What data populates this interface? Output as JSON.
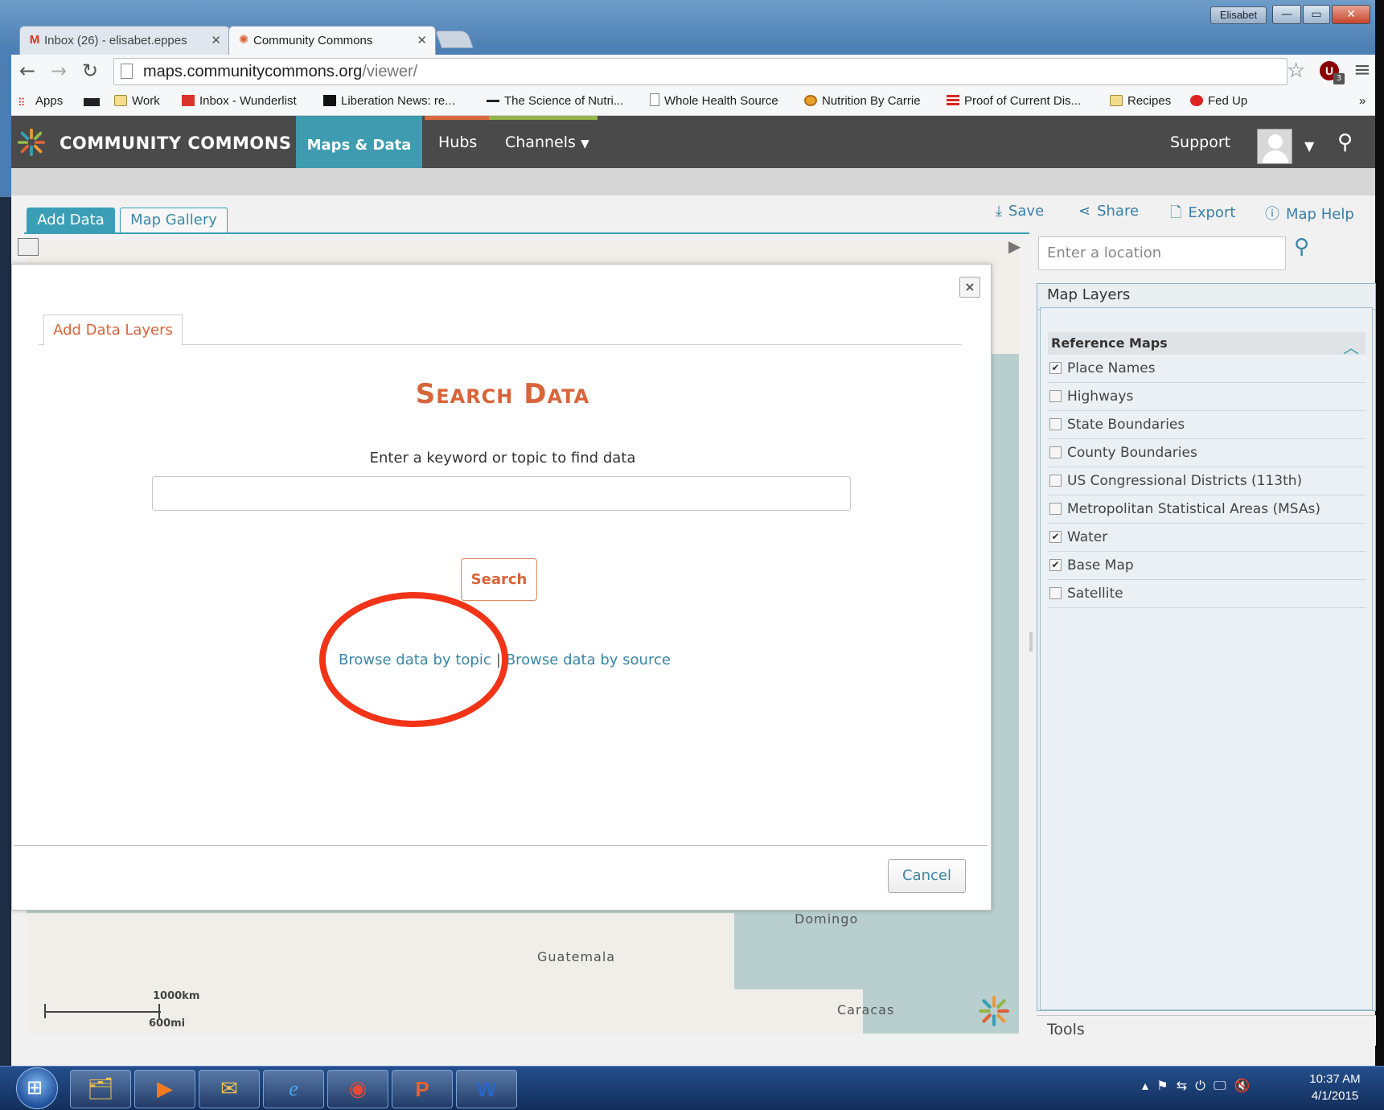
{
  "window": {
    "user_label": "Elisabet"
  },
  "browser": {
    "tabs": [
      {
        "label": "Inbox (26) - elisabet.eppes",
        "icon": "gmail-icon"
      },
      {
        "label": "Community Commons",
        "icon": "community-commons-icon"
      }
    ],
    "url_host": "maps.communitycommons.org",
    "url_path": "/viewer/",
    "bookmarks": [
      {
        "label": "Apps",
        "icon": "apps-grid-icon"
      },
      {
        "label": "",
        "icon": "bbc-icon"
      },
      {
        "label": "Work",
        "icon": "folder-icon"
      },
      {
        "label": "Inbox - Wunderlist",
        "icon": "wunderlist-icon"
      },
      {
        "label": "Liberation News: re...",
        "icon": "liberation-news-icon"
      },
      {
        "label": "The Science of Nutri...",
        "icon": "science-nutrition-icon"
      },
      {
        "label": "Whole Health Source",
        "icon": "page-icon"
      },
      {
        "label": "Nutrition By Carrie",
        "icon": "nutrition-carrie-icon"
      },
      {
        "label": "Proof of Current Dis...",
        "icon": "flag-icon"
      },
      {
        "label": "Recipes",
        "icon": "folder-icon"
      },
      {
        "label": "Fed Up",
        "icon": "fed-up-icon"
      }
    ],
    "bookmarks_overflow": "»",
    "extension_badge": "3"
  },
  "site": {
    "brand": "COMMUNITY COMMONS",
    "nav": {
      "maps": "Maps & Data",
      "hubs": "Hubs",
      "channels": "Channels"
    },
    "support": "Support",
    "accent": "#3f9cb0",
    "orange": "#d8643a"
  },
  "viewer": {
    "tabs": {
      "add_data": "Add Data",
      "map_gallery": "Map Gallery"
    },
    "actions": {
      "save": "Save",
      "share": "Share",
      "export": "Export",
      "help": "Map Help"
    },
    "location_placeholder": "Enter a location"
  },
  "map": {
    "labels": {
      "domingo": "Domingo",
      "guatemala": "Guatemala",
      "caracas": "Caracas"
    },
    "scale_km": "1000km",
    "scale_mi": "600mi"
  },
  "modal": {
    "tab": "Add Data Layers",
    "title": "Search Data",
    "prompt": "Enter a keyword or topic to find data",
    "search_value": "",
    "search_button": "Search",
    "browse_topic": "Browse data by topic",
    "browse_separator": "|",
    "browse_source": "Browse data by source",
    "cancel": "Cancel",
    "close_symbol": "×"
  },
  "layers": {
    "title": "Map Layers",
    "group": "Reference Maps",
    "items": [
      {
        "label": "Place Names",
        "checked": true
      },
      {
        "label": "Highways",
        "checked": false
      },
      {
        "label": "State Boundaries",
        "checked": false
      },
      {
        "label": "County Boundaries",
        "checked": false
      },
      {
        "label": "US Congressional Districts (113th)",
        "checked": false
      },
      {
        "label": "Metropolitan Statistical Areas (MSAs)",
        "checked": false
      },
      {
        "label": "Water",
        "checked": true
      },
      {
        "label": "Base Map",
        "checked": true
      },
      {
        "label": "Satellite",
        "checked": false
      }
    ],
    "tools": "Tools"
  },
  "taskbar": {
    "time": "10:37 AM",
    "date": "4/1/2015",
    "apps": [
      "windows-explorer-icon",
      "media-player-icon",
      "outlook-icon",
      "internet-explorer-icon",
      "chrome-icon",
      "powerpoint-icon",
      "word-icon"
    ]
  }
}
